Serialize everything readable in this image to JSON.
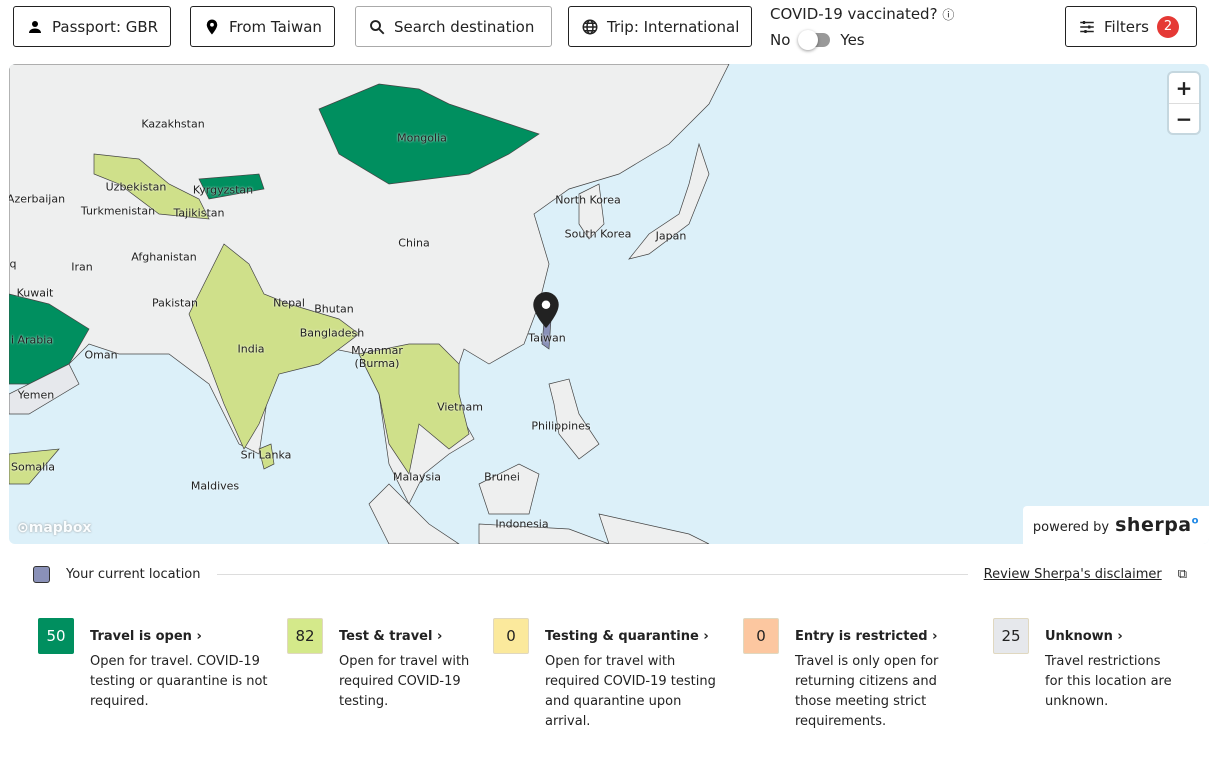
{
  "toolbar": {
    "passport": "Passport: GBR",
    "from": "From Taiwan",
    "search_placeholder": "Search destination",
    "trip": "Trip: International",
    "vaccinated_label": "COVID-19 vaccinated?",
    "toggle_no": "No",
    "toggle_yes": "Yes",
    "vaccinated": false,
    "filters": "Filters",
    "filters_count": "2"
  },
  "map": {
    "labels": [
      "Kazakhstan",
      "Mongolia",
      "Uzbekistan",
      "Kyrgyzstan",
      "Azerbaijan",
      "Turkmenistan",
      "Tajikistan",
      "North Korea",
      "China",
      "South Korea",
      "Japan",
      "Iran",
      "Afghanistan",
      "Kuwait",
      "Pakistan",
      "Nepal",
      "Bhutan",
      "Bangladesh",
      "Taiwan",
      "i Arabia",
      "Oman",
      "India",
      "Myanmar\n(Burma)",
      "Vietnam",
      "Yemen",
      "Philippines",
      "Sri Lanka",
      "Somalia",
      "Malaysia",
      "Maldives",
      "Brunei",
      "Indonesia",
      "q"
    ],
    "zoom_in": "+",
    "zoom_out": "−",
    "attribution": "mapbox",
    "powered_by": "powered by",
    "brand": "sherpa"
  },
  "location": {
    "label": "Your current location",
    "disclaimer": "Review Sherpa's disclaimer"
  },
  "legend": [
    {
      "count": "50",
      "title": "Travel is open ›",
      "desc": "Open for travel. COVID-19 testing or quarantine is not required.",
      "color": "#008f5f"
    },
    {
      "count": "82",
      "title": "Test & travel ›",
      "desc": "Open for travel with required COVID-19 testing.",
      "color": "#d4e98a"
    },
    {
      "count": "0",
      "title": "Testing & quarantine ›",
      "desc": "Open for travel with required COVID-19 testing and quarantine upon arrival.",
      "color": "#fbe99c"
    },
    {
      "count": "0",
      "title": "Entry is restricted ›",
      "desc": "Travel is only open for returning citizens and those meeting strict requirements.",
      "color": "#fcc7a0"
    },
    {
      "count": "25",
      "title": "Unknown ›",
      "desc": "Travel restrictions for this location are unknown.",
      "color": "#e6e8ec"
    }
  ]
}
